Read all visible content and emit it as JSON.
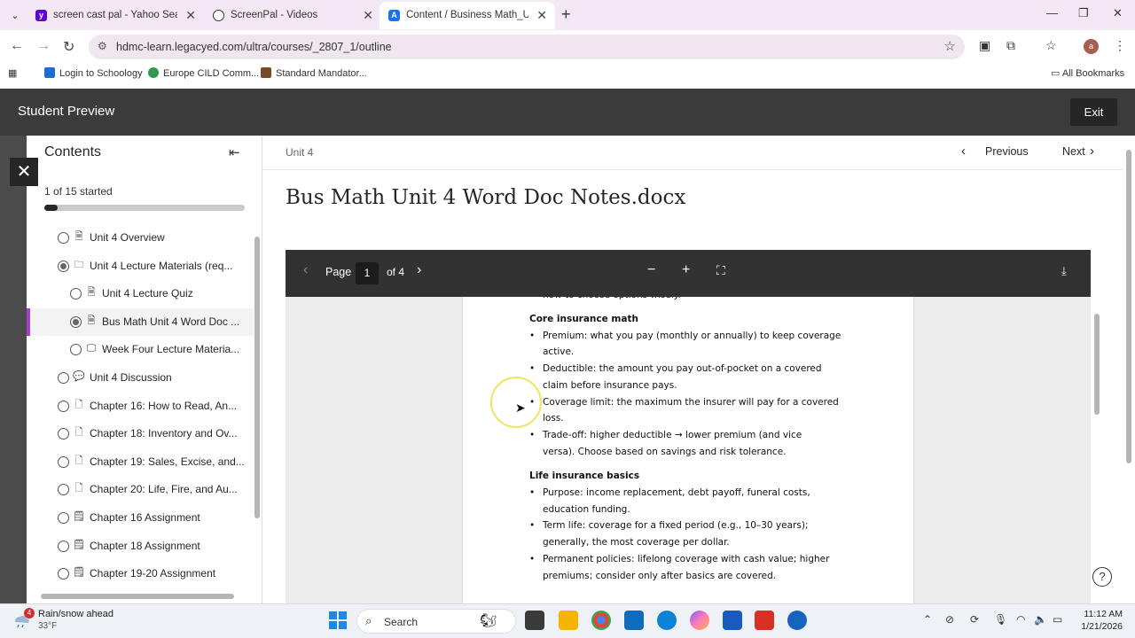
{
  "browser": {
    "tabs": [
      {
        "title": "screen cast pal - Yahoo Search R",
        "favicon_color": "#6001d2",
        "favicon_char": "y!"
      },
      {
        "title": "ScreenPal - Videos",
        "favicon_color": "#333333",
        "favicon_char": "◎"
      },
      {
        "title": "Content / Business Math_UTAA",
        "favicon_color": "#1a73e8",
        "favicon_char": "A"
      }
    ],
    "url": "hdmc-learn.legacyed.com/ultra/courses/_2807_1/outline",
    "bookmarks": [
      "Login to Schoology",
      "Europe CILD Comm...",
      "Standard Mandator..."
    ],
    "all_bookmarks": "All Bookmarks",
    "profile_initial": "a"
  },
  "preview": {
    "title": "Student Preview",
    "exit_label": "Exit"
  },
  "sidebar": {
    "heading": "Contents",
    "progress_text": "1 of 15 started",
    "progress_fraction": 0.067,
    "items": [
      {
        "label": "Unit 4 Overview",
        "icon": "document-icon",
        "status": "not-started",
        "indent": 0
      },
      {
        "label": "Unit 4 Lecture Materials (req...",
        "icon": "folder-icon",
        "status": "in-progress",
        "indent": 0
      },
      {
        "label": "Unit 4 Lecture Quiz",
        "icon": "document-icon",
        "status": "not-started",
        "indent": 1
      },
      {
        "label": "Bus Math Unit 4 Word Doc ...",
        "icon": "document-icon",
        "status": "in-progress",
        "indent": 1,
        "current": true
      },
      {
        "label": "Week Four Lecture Materia...",
        "icon": "presentation-icon",
        "status": "not-started",
        "indent": 1
      },
      {
        "label": "Unit 4 Discussion",
        "icon": "discussion-icon",
        "status": "not-started",
        "indent": 0
      },
      {
        "label": "Chapter 16: How to Read, An...",
        "icon": "file-icon",
        "status": "not-started",
        "indent": 0
      },
      {
        "label": "Chapter 18: Inventory and Ov...",
        "icon": "file-icon",
        "status": "not-started",
        "indent": 0
      },
      {
        "label": "Chapter 19: Sales, Excise, and...",
        "icon": "file-icon",
        "status": "not-started",
        "indent": 0
      },
      {
        "label": "Chapter 20: Life, Fire, and Au...",
        "icon": "file-icon",
        "status": "not-started",
        "indent": 0
      },
      {
        "label": "Chapter 16 Assignment",
        "icon": "assignment-icon",
        "status": "not-started",
        "indent": 0
      },
      {
        "label": "Chapter 18 Assignment",
        "icon": "assignment-icon",
        "status": "not-started",
        "indent": 0
      },
      {
        "label": "Chapter 19-20 Assignment",
        "icon": "assignment-icon",
        "status": "not-started",
        "indent": 0
      }
    ]
  },
  "main": {
    "breadcrumb": "Unit 4",
    "previous_label": "Previous",
    "next_label": "Next",
    "title": "Bus Math Unit 4 Word Doc Notes.docx"
  },
  "viewer": {
    "page_label": "Page",
    "page_number": "1",
    "page_total": "of 4"
  },
  "document": {
    "top_fragment": "how to choose options wisely.",
    "sections": [
      {
        "heading": "Core insurance math",
        "bullets": [
          [
            "Premium: what you pay (monthly or annually) to keep coverage",
            "active."
          ],
          [
            "Deductible: the amount you pay out-of-pocket on a covered",
            "claim before insurance pays."
          ],
          [
            "Coverage limit: the maximum the insurer will pay for a covered",
            "loss."
          ],
          [
            "Trade-off: higher deductible → lower premium (and vice",
            "versa). Choose based on savings and risk tolerance."
          ]
        ]
      },
      {
        "heading": "Life insurance basics",
        "bullets": [
          [
            "Purpose: income replacement, debt payoff, funeral costs,",
            "education funding."
          ],
          [
            "Term life: coverage for a fixed period (e.g., 10–30 years);",
            "generally, the most coverage per dollar."
          ],
          [
            "Permanent policies: lifelong coverage with cash value; higher",
            "premiums; consider only after basics are covered."
          ]
        ]
      }
    ]
  },
  "taskbar": {
    "weather_text": "Rain/snow ahead",
    "weather_temp": "33°F",
    "weather_badge": "4",
    "search_label": "Search",
    "time": "11:12 AM",
    "date": "1/21/2026"
  }
}
